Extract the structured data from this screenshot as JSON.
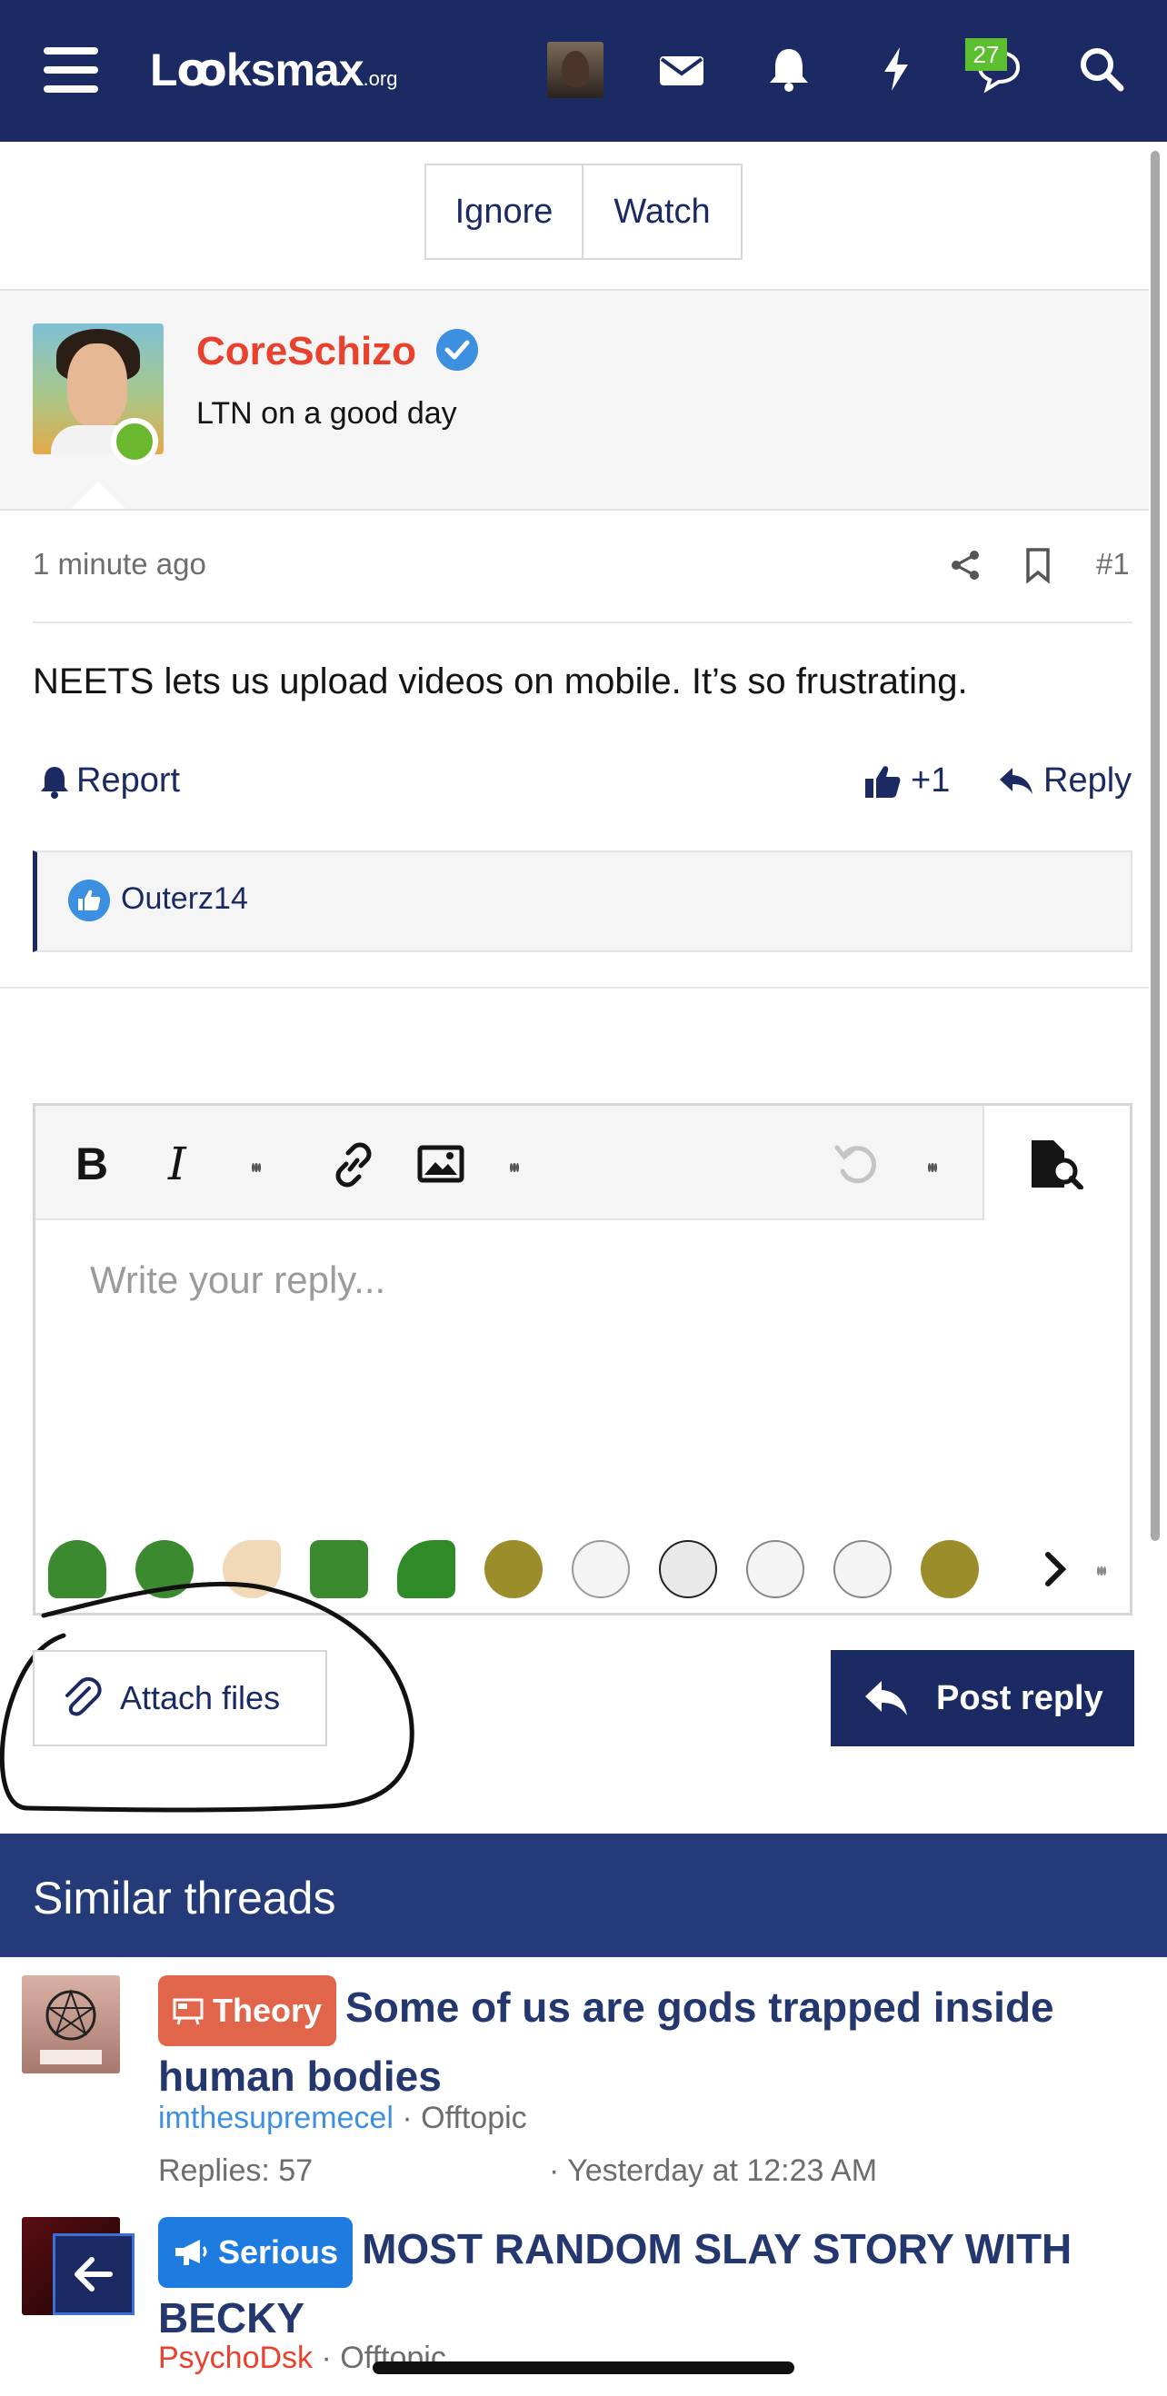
{
  "header": {
    "logo_text": "Lꝏksmax",
    "logo_suffix": ".org",
    "notifications_badge": "27",
    "colors": {
      "bar": "#1b2a63",
      "badge": "#5bbf2f"
    },
    "icons": [
      "menu-icon",
      "avatar",
      "mail-icon",
      "bell-icon",
      "bolt-icon",
      "chat-icon",
      "search-icon"
    ]
  },
  "thread_actions": {
    "ignore_label": "Ignore",
    "watch_label": "Watch"
  },
  "post": {
    "username": "CoreSchizo",
    "username_color": "#e8412e",
    "user_title": "LTN on a good day",
    "time": "1 minute ago",
    "number": "#1",
    "body": "NEETS lets us upload videos on mobile. It’s so frustrating.",
    "report_label": "Report",
    "like_count": "+1",
    "reply_label": "Reply",
    "liked_by": "Outerz14"
  },
  "editor": {
    "placeholder": "Write your reply...",
    "toolbar": [
      "bold",
      "italic",
      "more",
      "link",
      "image",
      "more",
      "undo",
      "more",
      "preview"
    ],
    "bold_label": "B",
    "italic_label": "I"
  },
  "buttons": {
    "attach_label": "Attach files",
    "post_reply_label": "Post reply"
  },
  "similar": {
    "title": "Similar threads",
    "threads": [
      {
        "prefix": "Theory",
        "prefix_color": "#e0654a",
        "title": "Some of us are gods trapped inside human bodies",
        "author": "imthesupremecel",
        "forum": "Offtopic",
        "replies": "Replies: 57",
        "date": "· Yesterday at 12:23 AM"
      },
      {
        "prefix": "Serious",
        "prefix_color": "#1e7be0",
        "title": "MOST RANDOM SLAY STORY WITH BECKY",
        "author": "PsychoDsk",
        "forum": "Offtopic"
      }
    ]
  }
}
